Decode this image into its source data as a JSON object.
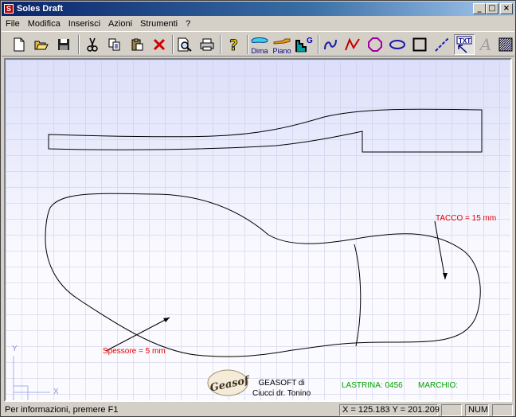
{
  "window": {
    "title": "Soles Draft",
    "app_icon_letter": "S",
    "buttons": {
      "minimize": "_",
      "maximize": "□",
      "close": "×"
    }
  },
  "menu": {
    "items": [
      "File",
      "Modifica",
      "Inserisci",
      "Azioni",
      "Strumenti",
      "?"
    ]
  },
  "toolbar": {
    "dima_label": "Dima",
    "piano_label": "Piano",
    "g_label": "G",
    "txt_label": "TXT",
    "text_tool_glyph": "A",
    "icons": [
      "new-file-icon",
      "open-folder-icon",
      "save-disk-icon",
      "cut-icon",
      "copy-icon",
      "paste-icon",
      "delete-icon",
      "print-preview-icon",
      "print-icon",
      "help-icon",
      "dima-icon",
      "piano-icon",
      "graph-g-icon",
      "curve-tool-icon",
      "polyline-tool-icon",
      "polygon-tool-icon",
      "ellipse-tool-icon",
      "rectangle-tool-icon",
      "dashed-line-tool-icon",
      "text-box-tool-icon",
      "text-tool-icon",
      "hatch-tool-icon"
    ]
  },
  "canvas": {
    "annotations": {
      "tacco": "TACCO = 15 mm",
      "spessore": "Spessore = 5 mm"
    },
    "company": {
      "logo_text": "Geasoft",
      "line1": "GEASOFT di",
      "line2": "Ciucci dr. Tonino"
    },
    "lastrina": "LASTRINA: 0456",
    "marchio": "MARCHIO:",
    "axis": {
      "y": "Y",
      "x": "X"
    }
  },
  "status": {
    "help_text": "Per informazioni, premere F1",
    "coords": "X = 125.183  Y = 201.209",
    "num": "NUM"
  },
  "colors": {
    "title_start": "#0a246a",
    "annotation_red": "#e00000",
    "label_green": "#00a000",
    "tool_blue": "#1a1aa8",
    "tool_red": "#c00000"
  }
}
